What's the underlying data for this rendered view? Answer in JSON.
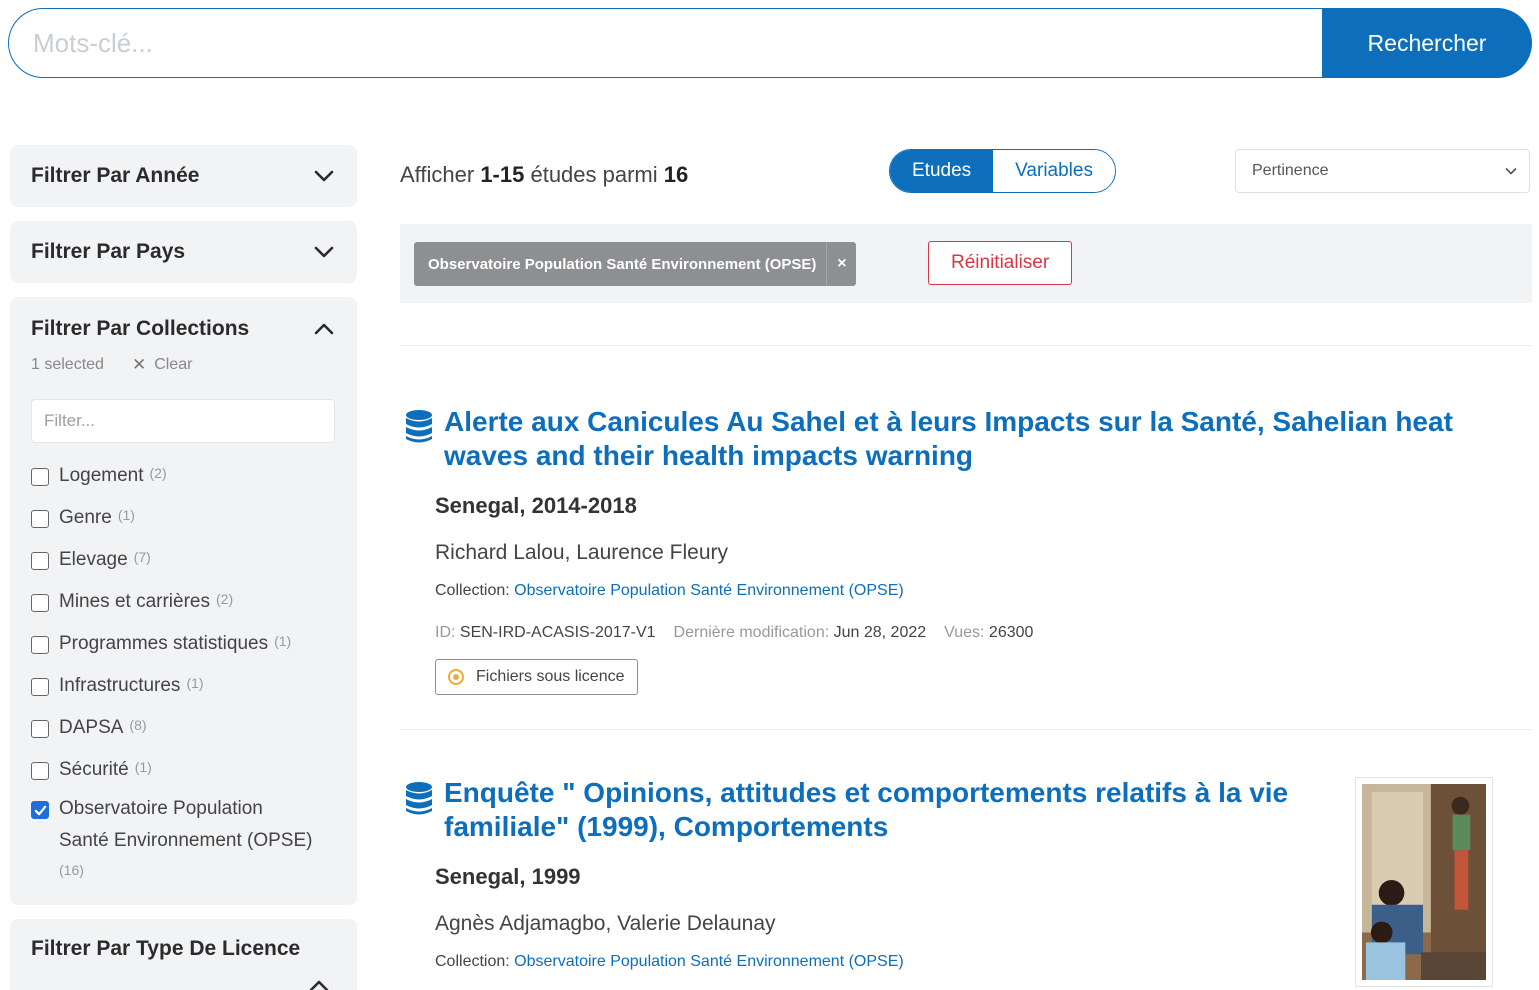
{
  "search": {
    "placeholder": "Mots-clé...",
    "button_label": "Rechercher"
  },
  "sidebar": {
    "facet_year": "Filtrer Par Année",
    "facet_country": "Filtrer Par Pays",
    "facet_collections": {
      "title": "Filtrer Par Collections",
      "selected_text": "1 selected",
      "clear_label": "Clear",
      "filter_placeholder": "Filter...",
      "options": [
        {
          "label": "Logement",
          "count": "(2)",
          "checked": false
        },
        {
          "label": "Genre",
          "count": "(1)",
          "checked": false
        },
        {
          "label": "Elevage",
          "count": "(7)",
          "checked": false
        },
        {
          "label": "Mines et carrières",
          "count": "(2)",
          "checked": false
        },
        {
          "label": "Programmes statistiques",
          "count": "(1)",
          "checked": false
        },
        {
          "label": "Infrastructures",
          "count": "(1)",
          "checked": false
        },
        {
          "label": "DAPSA",
          "count": "(8)",
          "checked": false
        },
        {
          "label": "Sécurité",
          "count": "(1)",
          "checked": false
        },
        {
          "label": "Observatoire Population Santé Environnement (OPSE)",
          "label_line1": "Observatoire Population",
          "label_line2": "Santé Environnement (OPSE)",
          "count": "(16)",
          "checked": true
        }
      ]
    },
    "facet_license": "Filtrer Par Type De Licence"
  },
  "main": {
    "summary": {
      "prefix": "Afficher ",
      "range": "1-15",
      "middle": " études parmi ",
      "total": "16"
    },
    "toggle": {
      "studies": "Etudes",
      "variables": "Variables"
    },
    "sort": {
      "selected": "Pertinence"
    },
    "active_filter": {
      "chip_label": "Observatoire Population Santé Environnement (OPSE)",
      "chip_close": "×",
      "reset_label": "Réinitialiser"
    },
    "results": [
      {
        "title_line1": "Alerte aux Canicules Au Sahel et à leurs Impacts sur la Santé, Sahelian heat",
        "title_line2": "waves and their health impacts warning",
        "country_years": "Senegal, 2014-2018",
        "authors": "Richard Lalou, Laurence Fleury",
        "collection_label": "Collection:",
        "collection_value": "Observatoire Population Santé Environnement (OPSE)",
        "id_label": "ID:",
        "id_value": "SEN-IRD-ACASIS-2017-V1",
        "modified_label": "Dernière modification:",
        "modified_value": "Jun 28, 2022",
        "views_label": "Vues:",
        "views_value": "26300",
        "license_badge": "Fichiers sous licence"
      },
      {
        "title_line1": "Enquête \" Opinions, attitudes et comportements relatifs à la vie",
        "title_line2": "familiale\" (1999), Comportements",
        "country_years": "Senegal, 1999",
        "authors": "Agnès Adjamagbo, Valerie Delaunay",
        "collection_label": "Collection:",
        "collection_value": "Observatoire Population Santé Environnement (OPSE)"
      }
    ]
  },
  "colors": {
    "primary": "#0d6ebc",
    "danger": "#dc3545",
    "panel_bg": "#f2f3f4",
    "chip_bg": "#8d8f91",
    "license_dot": "#f0a93a"
  },
  "icons": [
    "chevron-down-icon",
    "chevron-up-icon",
    "close-icon",
    "checkbox-icon",
    "database-icon",
    "license-dot-icon"
  ]
}
